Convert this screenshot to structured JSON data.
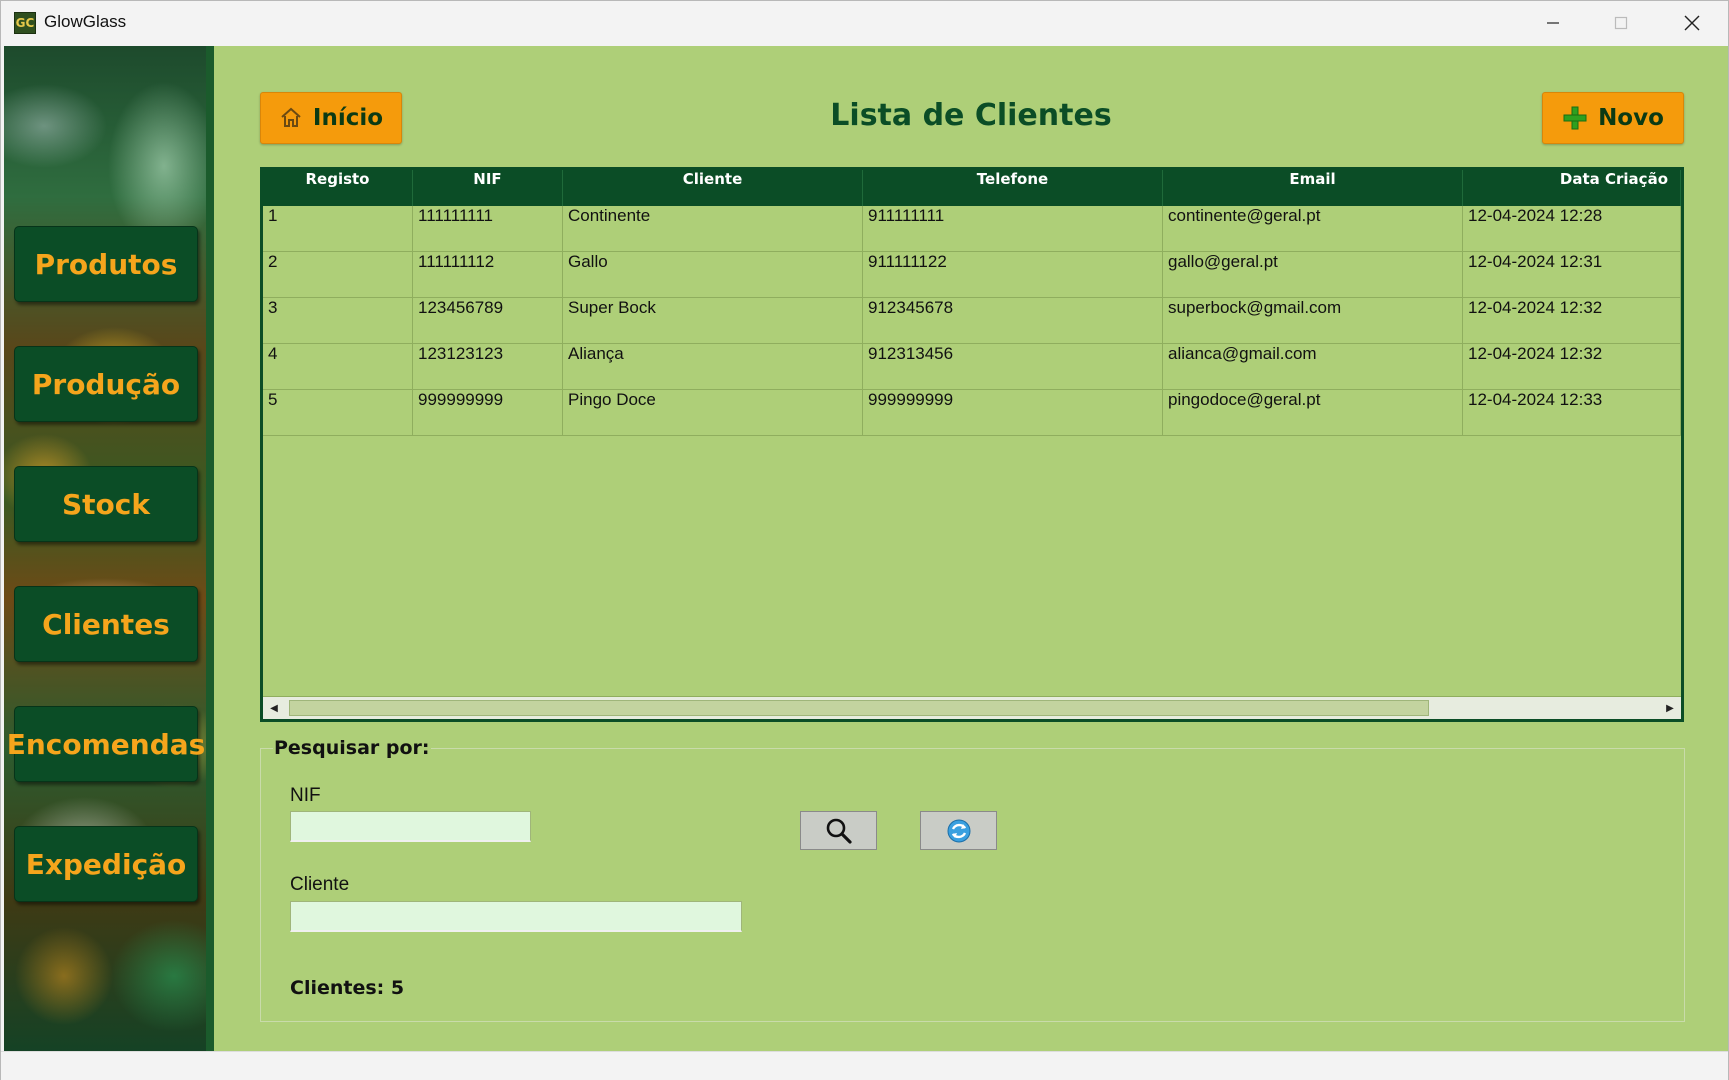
{
  "window": {
    "title": "GlowGlass",
    "icon_text": "GC"
  },
  "sidebar": {
    "items": [
      {
        "label": "Produtos"
      },
      {
        "label": "Produção"
      },
      {
        "label": "Stock"
      },
      {
        "label": "Clientes"
      },
      {
        "label": "Encomendas"
      },
      {
        "label": "Expedição"
      }
    ]
  },
  "header": {
    "home_label": "Início",
    "title": "Lista de Clientes",
    "new_label": "Novo"
  },
  "table": {
    "columns": [
      "Registo",
      "NIF",
      "Cliente",
      "Telefone",
      "Email",
      "Data Criação"
    ],
    "rows": [
      [
        "1",
        "111111111",
        "Continente",
        "911111111",
        "continente@geral.pt",
        "12-04-2024 12:28"
      ],
      [
        "2",
        "111111112",
        "Gallo",
        "911111122",
        "gallo@geral.pt",
        "12-04-2024 12:31"
      ],
      [
        "3",
        "123456789",
        "Super Bock",
        "912345678",
        "superbock@gmail.com",
        "12-04-2024 12:32"
      ],
      [
        "4",
        "123123123",
        "Aliança",
        "912313456",
        "alianca@gmail.com",
        "12-04-2024 12:32"
      ],
      [
        "5",
        "999999999",
        "Pingo Doce",
        "999999999",
        "pingodoce@geral.pt",
        "12-04-2024 12:33"
      ]
    ]
  },
  "search": {
    "legend": "Pesquisar por:",
    "nif_label": "NIF",
    "nif_value": "",
    "cliente_label": "Cliente",
    "cliente_value": "",
    "count_label": "Clientes: 5"
  },
  "colors": {
    "background": "#aecf78",
    "dark_green": "#0b4d26",
    "orange": "#f59b0c"
  },
  "icons": [
    "home-icon",
    "plus-icon",
    "search-icon",
    "refresh-icon"
  ]
}
